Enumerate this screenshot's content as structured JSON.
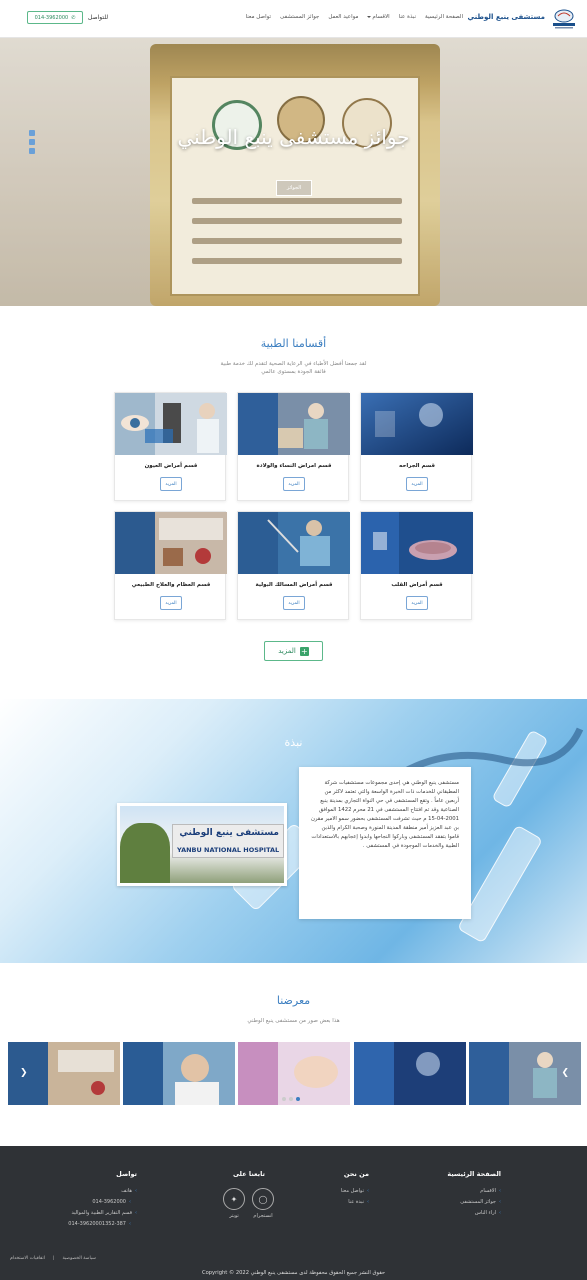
{
  "header": {
    "brand": "مستشفى ينبع الوطني",
    "nav": [
      {
        "label": "الصفحة الرئيسية"
      },
      {
        "label": "نبذة عنا"
      },
      {
        "label": "الاقسام",
        "dropdown": true
      },
      {
        "label": "مواعيد العمل"
      },
      {
        "label": "جوائز المستشفى"
      },
      {
        "label": "تواصل معنا"
      }
    ],
    "contact_label": "للتواصل",
    "phone": "014-3962000"
  },
  "hero": {
    "title": "جوائز مستشفى ينبع الوطني",
    "button": "الجوائز"
  },
  "departments": {
    "title": "أقسامنا الطبية",
    "subtitle_line1": "لقد جمعنا أفضل الأطباء في الرعاية الصحية لتقدم لك خدمة طبية",
    "subtitle_line2": "فائقة الجودة بمستوى عالمي",
    "cards": [
      {
        "title": "قسم الجراحه",
        "button": "المزيد"
      },
      {
        "title": "قسم امراض النساء والولادة",
        "button": "المزيد"
      },
      {
        "title": "قسم أمراض العيون",
        "button": "المزيد"
      },
      {
        "title": "قسم أمراض القلب",
        "button": "المزيد"
      },
      {
        "title": "قسم أمراض المسالك البولية",
        "button": "المزيد"
      },
      {
        "title": "قسم العظام والعلاج الطبيعي",
        "button": "المزيد"
      }
    ],
    "more_button": "المزيد"
  },
  "about": {
    "title": "نبذة",
    "text": "مستشفى ينبع الوطني هي إحدى مجموعات مستشفيات شركة المطيقاني للخدمات ذات الخبرة الواسعة والتي تعتمد لاكثر من أربعين عاماً . وتقع المستشفى في حي النواة التجاري بمدينة ينبع الصناعية وقد تم افتتاح المستشفى في 21 محرم 1422 الموافق 2001-04-15 م حيث تشرفت المستشفى بحضور سمو الامير مقرن بن عبد العزيز أمير منطقة المدينة المنورة وصحبة الكرام والذين قاموا بتفقد المستشفى وباركوا النجاحها وابدوا إعجابهم بالاستعدادات الطبية والخدمات الموجودة في المستشفى .",
    "sign_ar": "مستشفى ينبع الوطني",
    "sign_en": "YANBU NATIONAL HOSPITAL"
  },
  "gallery": {
    "title": "معرضنا",
    "subtitle": "هذا بعض صور من مستشفى ينبع الوطني"
  },
  "footer": {
    "home_col": {
      "title": "الصفحة الرئيسية",
      "items": [
        "الاقسام",
        "جوائز المستشفى",
        "اراء الناس"
      ]
    },
    "about_col": {
      "title": "من نحن",
      "items": [
        "تواصل معنا",
        "نبذة عنا"
      ]
    },
    "follow_col": {
      "title": "تابعنا على",
      "instagram": "انستجرام",
      "twitter": "تويتر"
    },
    "contact_col": {
      "title": "تواصل",
      "items": [
        "هاتف",
        "014-3962000",
        "قسم التقارير الطبية والمواليد",
        "014-39620001352-387"
      ]
    },
    "bottom_links": [
      "سياسة الخصوصية",
      "اتفاقيات الاستخدام"
    ],
    "copyright": "حقوق النشر جميع الحقوق محفوظة لدى مستشفى ينبع الوطني 2022 © Copyright"
  }
}
